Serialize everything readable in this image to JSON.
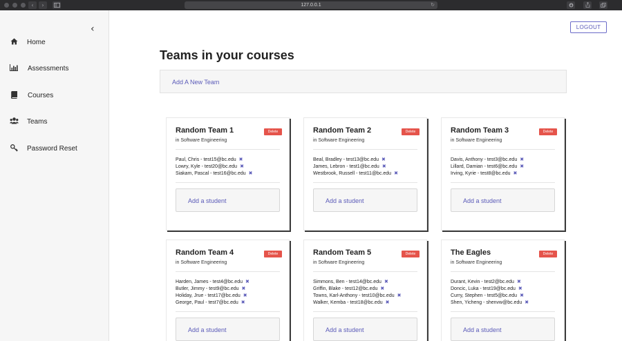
{
  "browser": {
    "url": "127.0.0.1",
    "back_glyph": "‹",
    "forward_glyph": "›",
    "reload_glyph": "↻"
  },
  "sidebar": {
    "collapse_glyph": "‹",
    "items": [
      {
        "label": "Home",
        "icon": "home-icon",
        "glyph": "⌂"
      },
      {
        "label": "Assessments",
        "icon": "bar-chart-icon",
        "glyph": ""
      },
      {
        "label": "Courses",
        "icon": "book-icon",
        "glyph": ""
      },
      {
        "label": "Teams",
        "icon": "users-icon",
        "glyph": ""
      },
      {
        "label": "Password Reset",
        "icon": "key-icon",
        "glyph": ""
      }
    ]
  },
  "header": {
    "logout_label": "LOGOUT"
  },
  "main": {
    "title": "Teams in your courses",
    "add_team_label": "Add A New Team"
  },
  "teams": [
    {
      "name": "Random Team 1",
      "course": "in Software Engineering",
      "delete_label": "Delete",
      "add_label": "Add a student",
      "members": [
        "Paul, Chris - test15@bc.edu",
        "Lowry, Kyle - test20@bc.edu",
        "Siakam, Pascal - test16@bc.edu"
      ]
    },
    {
      "name": "Random Team 2",
      "course": "in Software Engineering",
      "delete_label": "Delete",
      "add_label": "Add a student",
      "members": [
        "Beal, Bradley - test13@bc.edu",
        "James, Lebron - test1@bc.edu",
        "Westbrook, Russell - test11@bc.edu"
      ]
    },
    {
      "name": "Random Team 3",
      "course": "in Software Engineering",
      "delete_label": "Delete",
      "add_label": "Add a student",
      "members": [
        "Davis, Anthony - test3@bc.edu",
        "Lillard, Damian - test6@bc.edu",
        "Irving, Kyrie - test8@bc.edu"
      ]
    },
    {
      "name": "Random Team 4",
      "course": "in Software Engineering",
      "delete_label": "Delete",
      "add_label": "Add a student",
      "members": [
        "Harden, James - test4@bc.edu",
        "Butler, Jimmy - test9@bc.edu",
        "Holiday, Jrue - test17@bc.edu",
        "George, Paul - test7@bc.edu"
      ]
    },
    {
      "name": "Random Team 5",
      "course": "in Software Engineering",
      "delete_label": "Delete",
      "add_label": "Add a student",
      "members": [
        "Simmons, Ben - test14@bc.edu",
        "Griffin, Blake - test12@bc.edu",
        "Towns, Karl-Anthony - test10@bc.edu",
        "Walker, Kemba - test18@bc.edu"
      ]
    },
    {
      "name": "The Eagles",
      "course": "in Software Engineering",
      "delete_label": "Delete",
      "add_label": "Add a student",
      "members": [
        "Durant, Kevin - test2@bc.edu",
        "Doncic, Luka - test19@bc.edu",
        "Curry, Stephen - test5@bc.edu",
        "Shen, Yicheng - shenvw@bc.edu"
      ]
    }
  ],
  "remove_glyph": "✖",
  "colors": {
    "accent": "#5a5ab8",
    "delete": "#e5544b",
    "sidebar_bg": "#f6f6f6"
  }
}
